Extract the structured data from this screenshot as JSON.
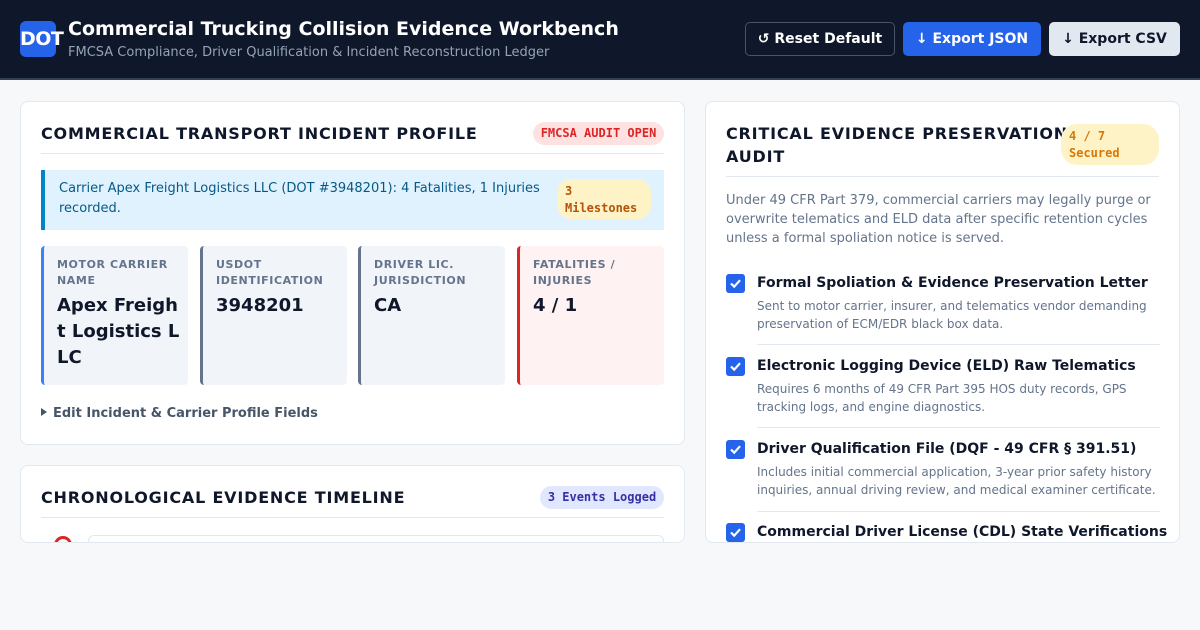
{
  "header": {
    "logo": "DOT",
    "title": "Commercial Trucking Collision Evidence Workbench",
    "subtitle": "FMCSA Compliance, Driver Qualification & Incident Reconstruction Ledger",
    "buttons": {
      "reset": "↺ Reset Default",
      "export_json": "↓ Export JSON",
      "export_csv": "↓ Export CSV"
    }
  },
  "profile": {
    "title": "COMMERCIAL TRANSPORT INCIDENT PROFILE",
    "badge": "FMCSA AUDIT OPEN",
    "banner_text": "Carrier Apex Freight Logistics LLC (DOT #3948201): 4 Fatalities, 1 Injuries recorded.",
    "milestones": "3 Milestones",
    "cards": [
      {
        "label": "MOTOR CARRIER NAME",
        "value": "Apex Freight Logistics LLC"
      },
      {
        "label": "USDOT IDENTIFICATION",
        "value": "3948201"
      },
      {
        "label": "DRIVER LIC. JURISDICTION",
        "value": "CA"
      },
      {
        "label": "FATALITIES / INJURIES",
        "value": "4 / 1"
      }
    ],
    "edit_link": "Edit Incident & Carrier Profile Fields"
  },
  "timeline": {
    "title": "CHRONOLOGICAL EVIDENCE TIMELINE",
    "badge": "3 Events Logged"
  },
  "audit": {
    "title_line1": "CRITICAL EVIDENCE PRESERVATION",
    "title_line2": "AUDIT",
    "badge": "4 / 7 Secured",
    "intro": "Under 49 CFR Part 379, commercial carriers may legally purge or overwrite telematics and ELD data after specific retention cycles unless a formal spoliation notice is served.",
    "items": [
      {
        "title": "Formal Spoliation & Evidence Preservation Letter",
        "desc": "Sent to motor carrier, insurer, and telematics vendor demanding preservation of ECM/EDR black box data.",
        "checked": true
      },
      {
        "title": "Electronic Logging Device (ELD) Raw Telematics",
        "desc": "Requires 6 months of 49 CFR Part 395 HOS duty records, GPS tracking logs, and engine diagnostics.",
        "checked": true
      },
      {
        "title": "Driver Qualification File (DQF - 49 CFR § 391.51)",
        "desc": "Includes initial commercial application, 3-year prior safety history inquiries, annual driving review, and medical examiner certificate.",
        "checked": true
      },
      {
        "title": "Commercial Driver License (CDL) State Verifications",
        "desc": "",
        "checked": true
      }
    ]
  },
  "colors": {
    "navy": "#0f172a",
    "accent_blue": "#2563eb",
    "alert_red": "#dc2626",
    "amber": "#b45309"
  },
  "icons": {
    "checkbox": "checkmark-icon",
    "disclosure": "triangle-right-icon",
    "timeline": "timeline-dot-icon"
  }
}
